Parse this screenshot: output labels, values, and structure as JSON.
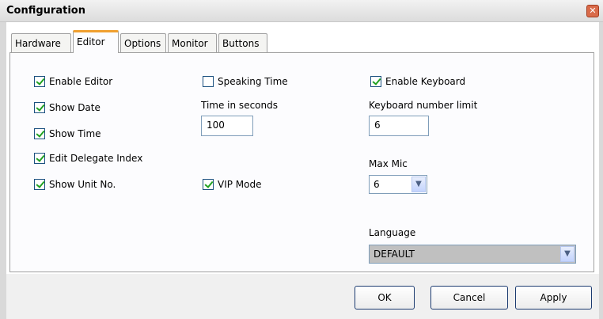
{
  "window": {
    "title": "Configuration",
    "close_glyph": "✕"
  },
  "tabs": [
    {
      "label": "Hardware",
      "active": false
    },
    {
      "label": "Editor",
      "active": true
    },
    {
      "label": "Options",
      "active": false
    },
    {
      "label": "Monitor",
      "active": false
    },
    {
      "label": "Buttons",
      "active": false
    }
  ],
  "editor": {
    "col1": [
      {
        "label": "Enable Editor",
        "checked": true
      },
      {
        "label": "Show Date",
        "checked": true
      },
      {
        "label": "Show Time",
        "checked": true
      },
      {
        "label": "Edit Delegate Index",
        "checked": true
      },
      {
        "label": "Show Unit No.",
        "checked": true
      }
    ],
    "speaking_time": {
      "label": "Speaking Time",
      "checked": false
    },
    "time_label": "Time in seconds",
    "time_value": "100",
    "vip_mode": {
      "label": "VIP Mode",
      "checked": true
    },
    "enable_keyboard": {
      "label": "Enable Keyboard",
      "checked": true
    },
    "keyboard_limit_label": "Keyboard number limit",
    "keyboard_limit_value": "6",
    "max_mic_label": "Max Mic",
    "max_mic_value": "6",
    "language_label": "Language",
    "language_value": "DEFAULT",
    "dropdown_glyph": "▼"
  },
  "buttons": {
    "ok": "OK",
    "cancel": "Cancel",
    "apply": "Apply"
  }
}
